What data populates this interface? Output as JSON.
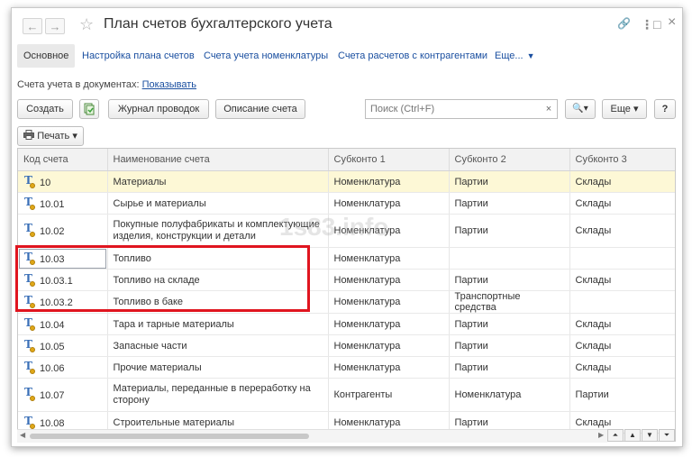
{
  "window": {
    "title": "План счетов бухгалтерского учета",
    "back_glyph": "←",
    "forward_glyph": "→",
    "star_glyph": "☆",
    "link_glyph": "🔗",
    "menu_glyph": "⋮",
    "maximize_glyph": "□",
    "close_glyph": "×"
  },
  "tabs": {
    "active": "Основное",
    "links": [
      "Настройка плана счетов",
      "Счета учета номенклатуры",
      "Счета расчетов с контрагентами"
    ],
    "more": "Еще...",
    "more_arrow": "▼"
  },
  "accounts_in_docs": {
    "label": "Счета учета в документах:",
    "link": "Показывать"
  },
  "toolbar": {
    "create": "Создать",
    "journal": "Журнал проводок",
    "description": "Описание счета",
    "search_placeholder": "Поиск (Ctrl+F)",
    "search_clear": "×",
    "search_icon": "🔍",
    "dropdown_arrow": "▾",
    "more": "Еще",
    "help": "?",
    "print": "Печать"
  },
  "table": {
    "columns": [
      "Код счета",
      "Наименование счета",
      "Субконто 1",
      "Субконто 2",
      "Субконто 3"
    ],
    "rows": [
      {
        "code": "10",
        "name": "Материалы",
        "s1": "Номенклатура",
        "s2": "Партии",
        "s3": "Склады",
        "selected": true
      },
      {
        "code": "10.01",
        "name": "Сырье и материалы",
        "s1": "Номенклатура",
        "s2": "Партии",
        "s3": "Склады"
      },
      {
        "code": "10.02",
        "name": "Покупные полуфабрикаты и комплектующие изделия, конструкции и детали",
        "s1": "Номенклатура",
        "s2": "Партии",
        "s3": "Склады",
        "tall": true
      },
      {
        "code": "10.03",
        "name": "Топливо",
        "s1": "Номенклатура",
        "s2": "",
        "s3": "",
        "current": true
      },
      {
        "code": "10.03.1",
        "name": "Топливо на складе",
        "s1": "Номенклатура",
        "s2": "Партии",
        "s3": "Склады"
      },
      {
        "code": "10.03.2",
        "name": "Топливо в баке",
        "s1": "Номенклатура",
        "s2": "Транспортные средства",
        "s3": ""
      },
      {
        "code": "10.04",
        "name": "Тара и тарные материалы",
        "s1": "Номенклатура",
        "s2": "Партии",
        "s3": "Склады"
      },
      {
        "code": "10.05",
        "name": "Запасные части",
        "s1": "Номенклатура",
        "s2": "Партии",
        "s3": "Склады"
      },
      {
        "code": "10.06",
        "name": "Прочие материалы",
        "s1": "Номенклатура",
        "s2": "Партии",
        "s3": "Склады"
      },
      {
        "code": "10.07",
        "name": "Материалы, переданные в переработку на сторону",
        "s1": "Контрагенты",
        "s2": "Номенклатура",
        "s3": "Партии",
        "tall": true
      },
      {
        "code": "10.08",
        "name": "Строительные материалы",
        "s1": "Номенклатура",
        "s2": "Партии",
        "s3": "Склады"
      }
    ]
  },
  "pager": [
    "⏶",
    "▲",
    "▼",
    "⏷"
  ],
  "watermark": "1s83.info",
  "colors": {
    "link": "#1a4fa0",
    "highlight": "#e0151f",
    "selected_row": "#fdf8d6"
  }
}
